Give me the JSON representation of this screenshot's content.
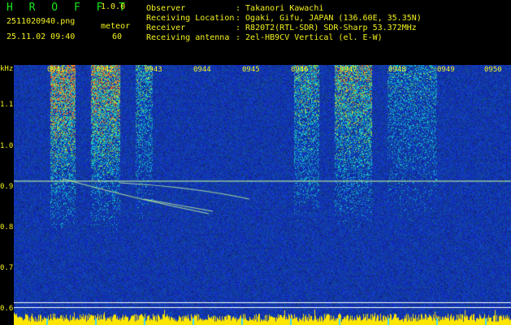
{
  "header": {
    "brand": "H R O F F T",
    "version": "1.0.0",
    "filename": "2511020940.png",
    "datetime": "25.11.02 09:40",
    "meteor_label": "meteor",
    "meteor_count": "60"
  },
  "info": [
    {
      "label": "Observer",
      "value": ": Takanori Kawachi"
    },
    {
      "label": "Receiving Location",
      "value": ": Ogaki, Gifu, JAPAN (136.60E, 35.35N)"
    },
    {
      "label": "Receiver",
      "value": ": R820T2(RTL-SDR) SDR-Sharp 53.372MHz"
    },
    {
      "label": "Receiving antenna",
      "value": ": 2el-HB9CV Vertical (el. E-W)"
    }
  ],
  "y_axis": {
    "unit": "kHz",
    "labels": [
      "1.1",
      "1.0",
      "0.9",
      "0.8",
      "0.7",
      "0.6"
    ]
  },
  "time_ticks": [
    "0941",
    "0942",
    "0943",
    "0944",
    "0945",
    "0946",
    "0947",
    "0948",
    "0949",
    "0950"
  ],
  "colors": {
    "background": "#000000",
    "text_green": "#19e619",
    "text_yellow": "#f2f21e",
    "spectrum_base": "#0a1a8c",
    "trace": "#c8ff9a",
    "baseline": "#ffe600"
  }
}
